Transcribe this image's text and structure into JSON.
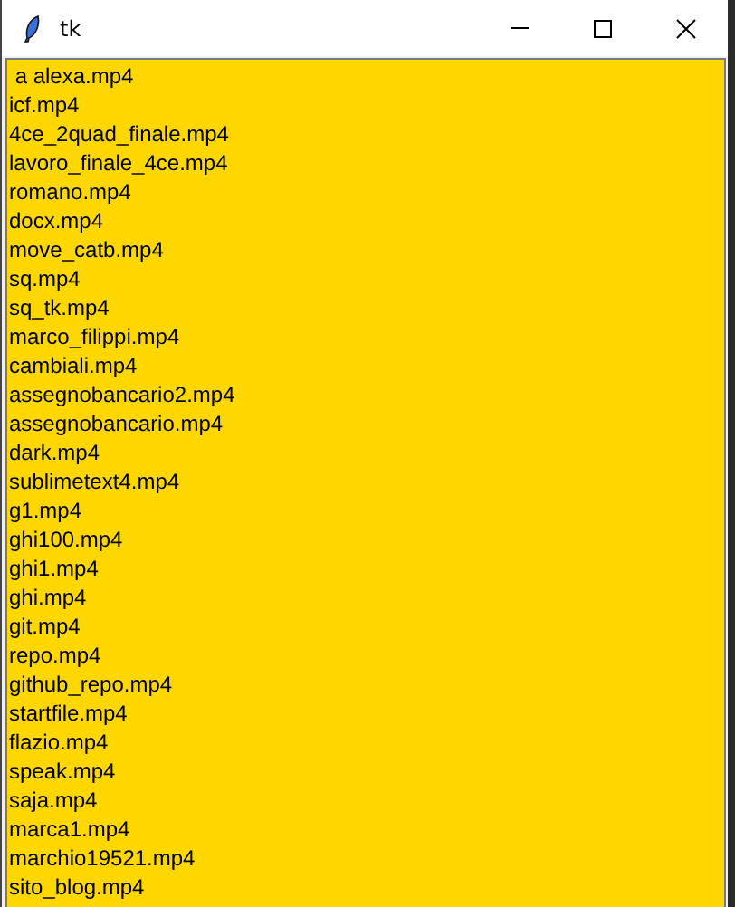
{
  "window": {
    "title": "tk"
  },
  "listbox": {
    "items": [
      " a alexa.mp4",
      "icf.mp4",
      "4ce_2quad_finale.mp4",
      "lavoro_finale_4ce.mp4",
      "romano.mp4",
      "docx.mp4",
      "move_catb.mp4",
      "sq.mp4",
      "sq_tk.mp4",
      "marco_filippi.mp4",
      "cambiali.mp4",
      "assegnobancario2.mp4",
      "assegnobancario.mp4",
      "dark.mp4",
      "sublimetext4.mp4",
      "g1.mp4",
      "ghi100.mp4",
      "ghi1.mp4",
      "ghi.mp4",
      "git.mp4",
      "repo.mp4",
      "github_repo.mp4",
      "startfile.mp4",
      "flazio.mp4",
      "speak.mp4",
      "saja.mp4",
      "marca1.mp4",
      "marchio19521.mp4",
      "sito_blog.mp4"
    ]
  }
}
